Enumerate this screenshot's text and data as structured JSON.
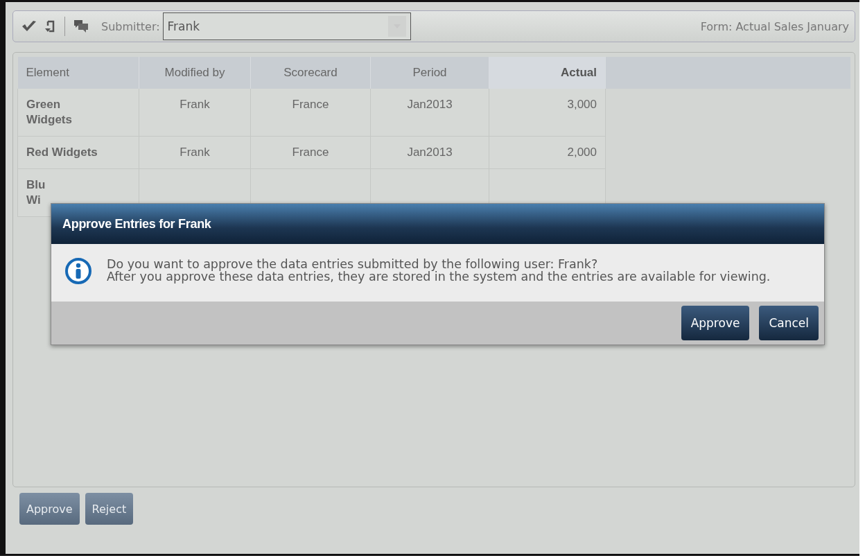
{
  "toolbar": {
    "submitter_label": "Submitter:",
    "submitter_value": "Frank",
    "form_label": "Form: Actual Sales January"
  },
  "table": {
    "columns": [
      "Element",
      "Modified by",
      "Scorecard",
      "Period",
      "Actual"
    ],
    "rows": [
      {
        "cells": [
          "Green\nWidgets",
          "Frank",
          "France",
          "Jan2013",
          "3,000"
        ]
      },
      {
        "cells": [
          "Red Widgets",
          "Frank",
          "France",
          "Jan2013",
          "2,000"
        ]
      },
      {
        "cells": [
          "Blu\nWi"
        ]
      }
    ]
  },
  "dialog": {
    "title": "Approve Entries for Frank",
    "message": [
      "Do you want to approve the data entries submitted by the following user: Frank?",
      "After you approve these data entries, they are stored in the system and the entries are available for viewing."
    ],
    "buttons": [
      "Approve",
      "Cancel"
    ]
  },
  "footer_buttons": [
    "Approve",
    "Reject"
  ]
}
